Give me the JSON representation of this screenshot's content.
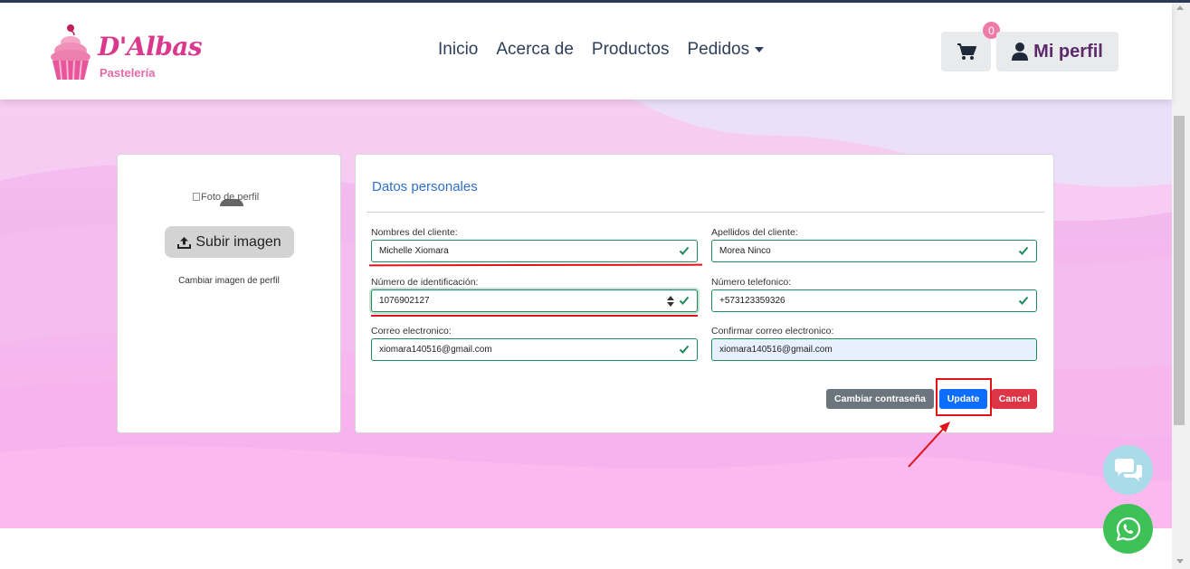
{
  "brand": {
    "name": "D'Albas",
    "subtitle": "Pastelería"
  },
  "nav": {
    "items": [
      "Inicio",
      "Acerca de",
      "Productos"
    ],
    "dropdown_label": "Pedidos"
  },
  "cart": {
    "count": "0"
  },
  "profile": {
    "label": "Mi perfil"
  },
  "photo": {
    "alt_text": "Foto de perfil",
    "upload_label": "Subir imagen",
    "change_text": "Cambiar imagen de perfil"
  },
  "form": {
    "title": "Datos personales",
    "fields": {
      "first_name": {
        "label": "Nombres del cliente:",
        "value": "Michelle Xiomara"
      },
      "last_name": {
        "label": "Apellidos del cliente:",
        "value": "Morea Ninco"
      },
      "id_number": {
        "label": "Número de identificación:",
        "value": "1076902127"
      },
      "phone": {
        "label": "Número telefonico:",
        "value": "+573123359326"
      },
      "email": {
        "label": "Correo electronico:",
        "value": "xiomara140516@gmail.com"
      },
      "email_confirm": {
        "label": "Confirmar correo electronico:",
        "value": "xiomara140516@gmail.com"
      }
    },
    "buttons": {
      "change_password": "Cambiar contraseña",
      "update": "Update",
      "cancel": "Cancel"
    }
  },
  "colors": {
    "brand_pink": "#d9388c",
    "valid_green": "#1f8a5b",
    "primary_blue": "#0d6efd",
    "danger_red": "#dc3545",
    "annotation_red": "#e0121a"
  },
  "icons": {
    "cart": "shopping-cart-icon",
    "profile": "user-icon",
    "upload": "upload-icon",
    "chat": "chat-bubbles-icon",
    "whatsapp": "whatsapp-icon",
    "valid": "check-icon"
  }
}
